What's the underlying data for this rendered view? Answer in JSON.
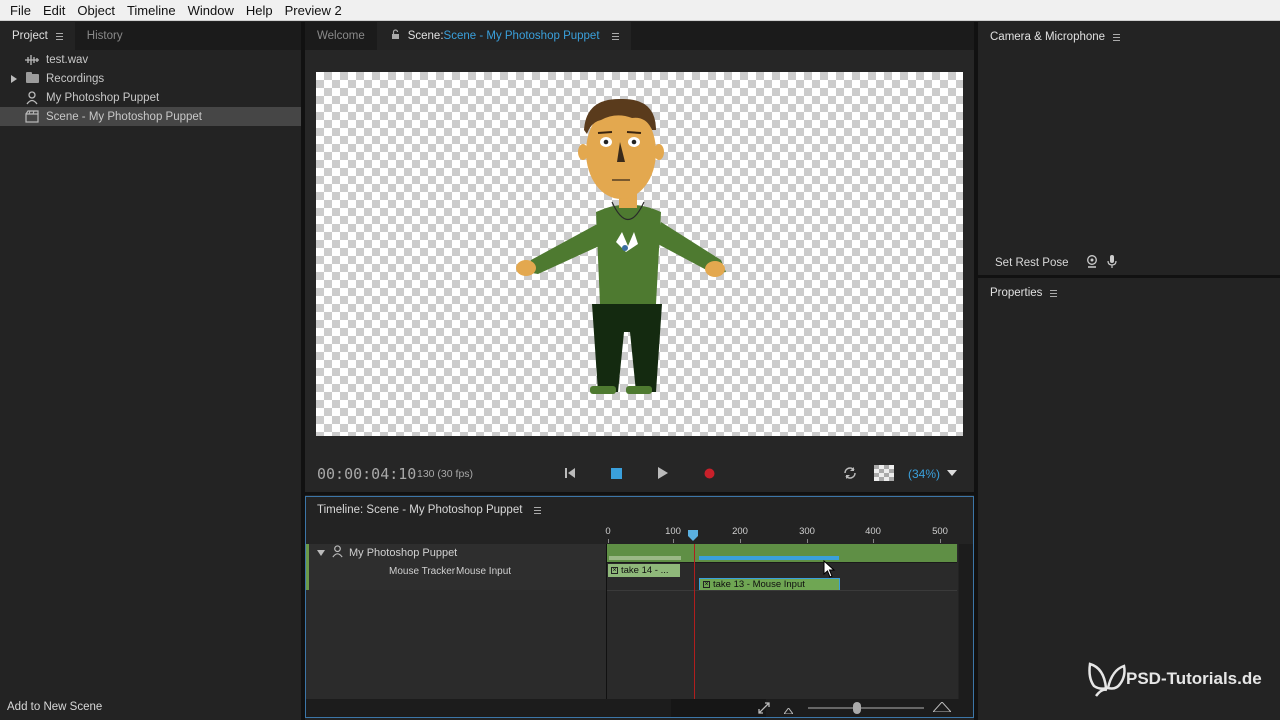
{
  "menu": [
    "File",
    "Edit",
    "Object",
    "Timeline",
    "Window",
    "Help",
    "Preview 2"
  ],
  "project_panel": {
    "tabs": [
      "Project",
      "History"
    ],
    "items": [
      {
        "label": "test.wav",
        "icon": "audio-icon"
      },
      {
        "label": "Recordings",
        "icon": "folder-icon"
      },
      {
        "label": "My Photoshop Puppet",
        "icon": "puppet-icon"
      },
      {
        "label": "Scene - My Photoshop Puppet",
        "icon": "scene-icon",
        "selected": true
      }
    ],
    "add_scene_label": "Add to New Scene"
  },
  "scene_panel": {
    "tabs": {
      "welcome": "Welcome",
      "scene_prefix": "Scene:",
      "scene_name": "Scene - My Photoshop Puppet"
    },
    "timecode": "00:00:04:10",
    "frame_info": "130 (30 fps)",
    "zoom": "(34%)"
  },
  "timeline": {
    "title": "Timeline: Scene - My Photoshop Puppet",
    "ruler_ticks": [
      "0",
      "100",
      "200",
      "300",
      "400",
      "500"
    ],
    "track_name": "My Photoshop Puppet",
    "behavior": "Mouse Tracker",
    "param": "Mouse Input",
    "takes": [
      {
        "label": "take 14 - ..."
      },
      {
        "label": "take 13 - Mouse Input"
      }
    ],
    "playhead_frame": 130
  },
  "camera_panel": {
    "title": "Camera & Microphone",
    "rest_pose_label": "Set Rest Pose"
  },
  "properties_panel": {
    "title": "Properties"
  },
  "watermark": "PSD-Tutorials.de",
  "colors": {
    "accent": "#3aa0dc",
    "track_green": "#5f8f45",
    "playhead": "#b01e1e",
    "record": "#c8202a"
  }
}
